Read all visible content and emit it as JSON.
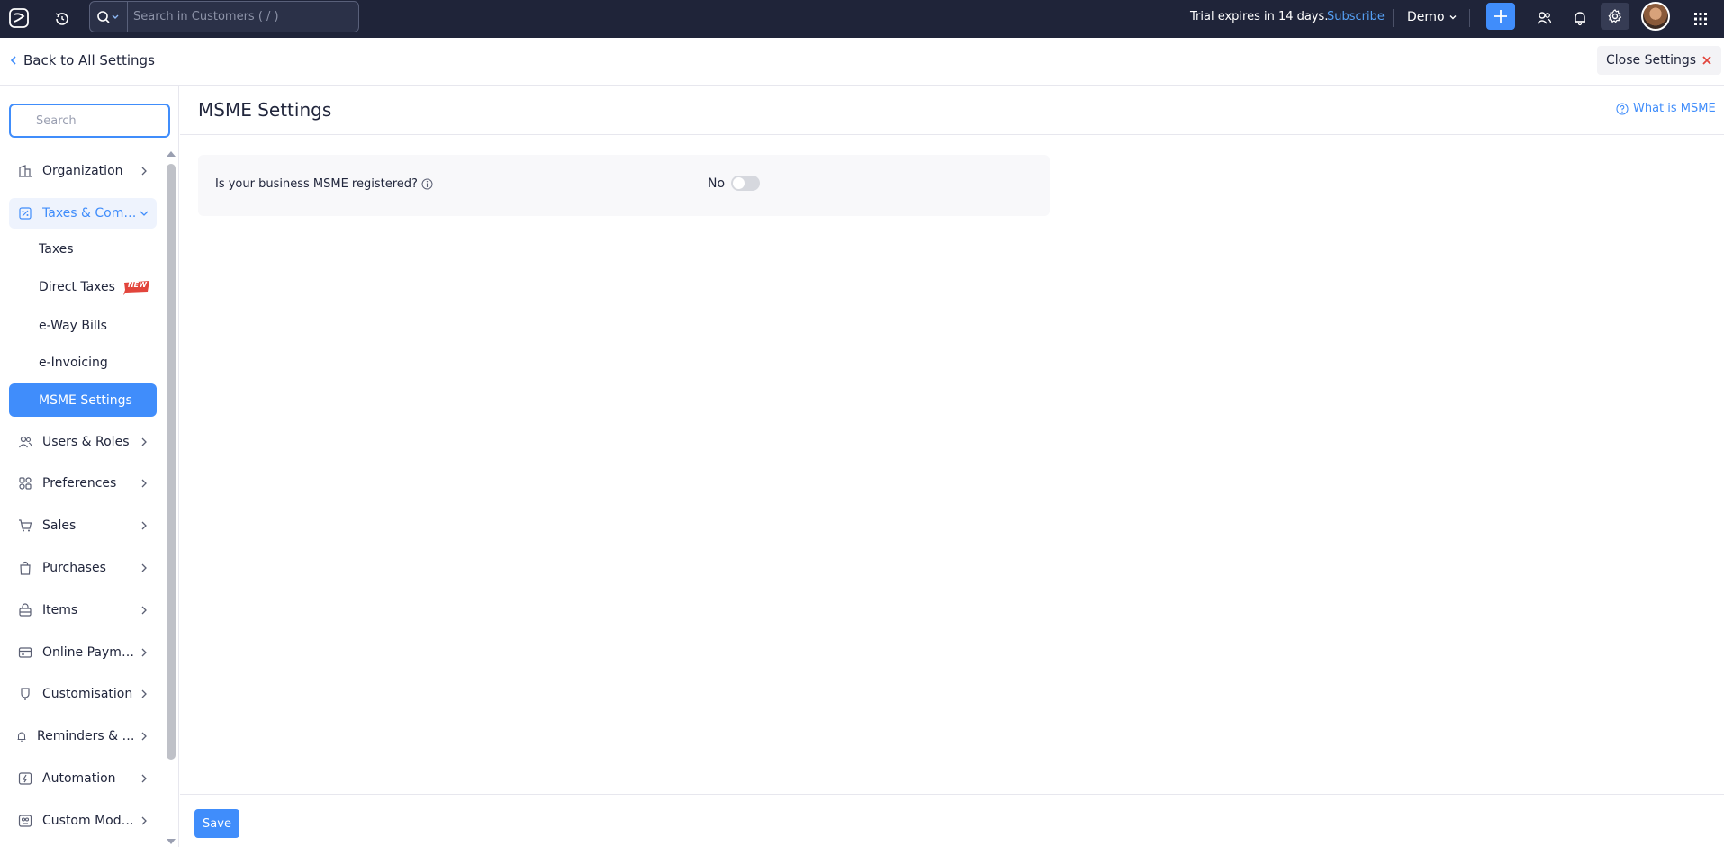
{
  "topbar": {
    "search_placeholder": "Search in Customers ( / )",
    "trial_text": "Trial expires in 14 days.",
    "subscribe_label": "Subscribe",
    "org_name": "Demo"
  },
  "header": {
    "back_label": "Back to All Settings",
    "close_label": "Close Settings"
  },
  "sidebar": {
    "search_placeholder": "Search",
    "items": [
      {
        "label": "Organization",
        "icon": "organization-icon"
      },
      {
        "label": "Taxes & Complia...",
        "icon": "taxes-icon"
      },
      {
        "label": "Users & Roles",
        "icon": "users-icon"
      },
      {
        "label": "Preferences",
        "icon": "preferences-icon"
      },
      {
        "label": "Sales",
        "icon": "cart-icon"
      },
      {
        "label": "Purchases",
        "icon": "bag-icon"
      },
      {
        "label": "Items",
        "icon": "basket-icon"
      },
      {
        "label": "Online Payments",
        "icon": "card-icon"
      },
      {
        "label": "Customisation",
        "icon": "brush-icon"
      },
      {
        "label": "Reminders & Noti...",
        "icon": "bell-icon"
      },
      {
        "label": "Automation",
        "icon": "bolt-icon"
      },
      {
        "label": "Custom Modules",
        "icon": "modules-icon"
      }
    ],
    "sub_items": [
      {
        "label": "Taxes"
      },
      {
        "label": "Direct Taxes",
        "badge": "NEW"
      },
      {
        "label": "e-Way Bills"
      },
      {
        "label": "e-Invoicing"
      },
      {
        "label": "MSME Settings"
      }
    ]
  },
  "main": {
    "title": "MSME Settings",
    "help_label": "What is MSME",
    "question": "Is your business MSME registered?",
    "toggle_value": "No",
    "save_label": "Save"
  },
  "colors": {
    "accent": "#408dfb",
    "topbar_bg": "#1f2439",
    "badge": "#e2453c"
  }
}
